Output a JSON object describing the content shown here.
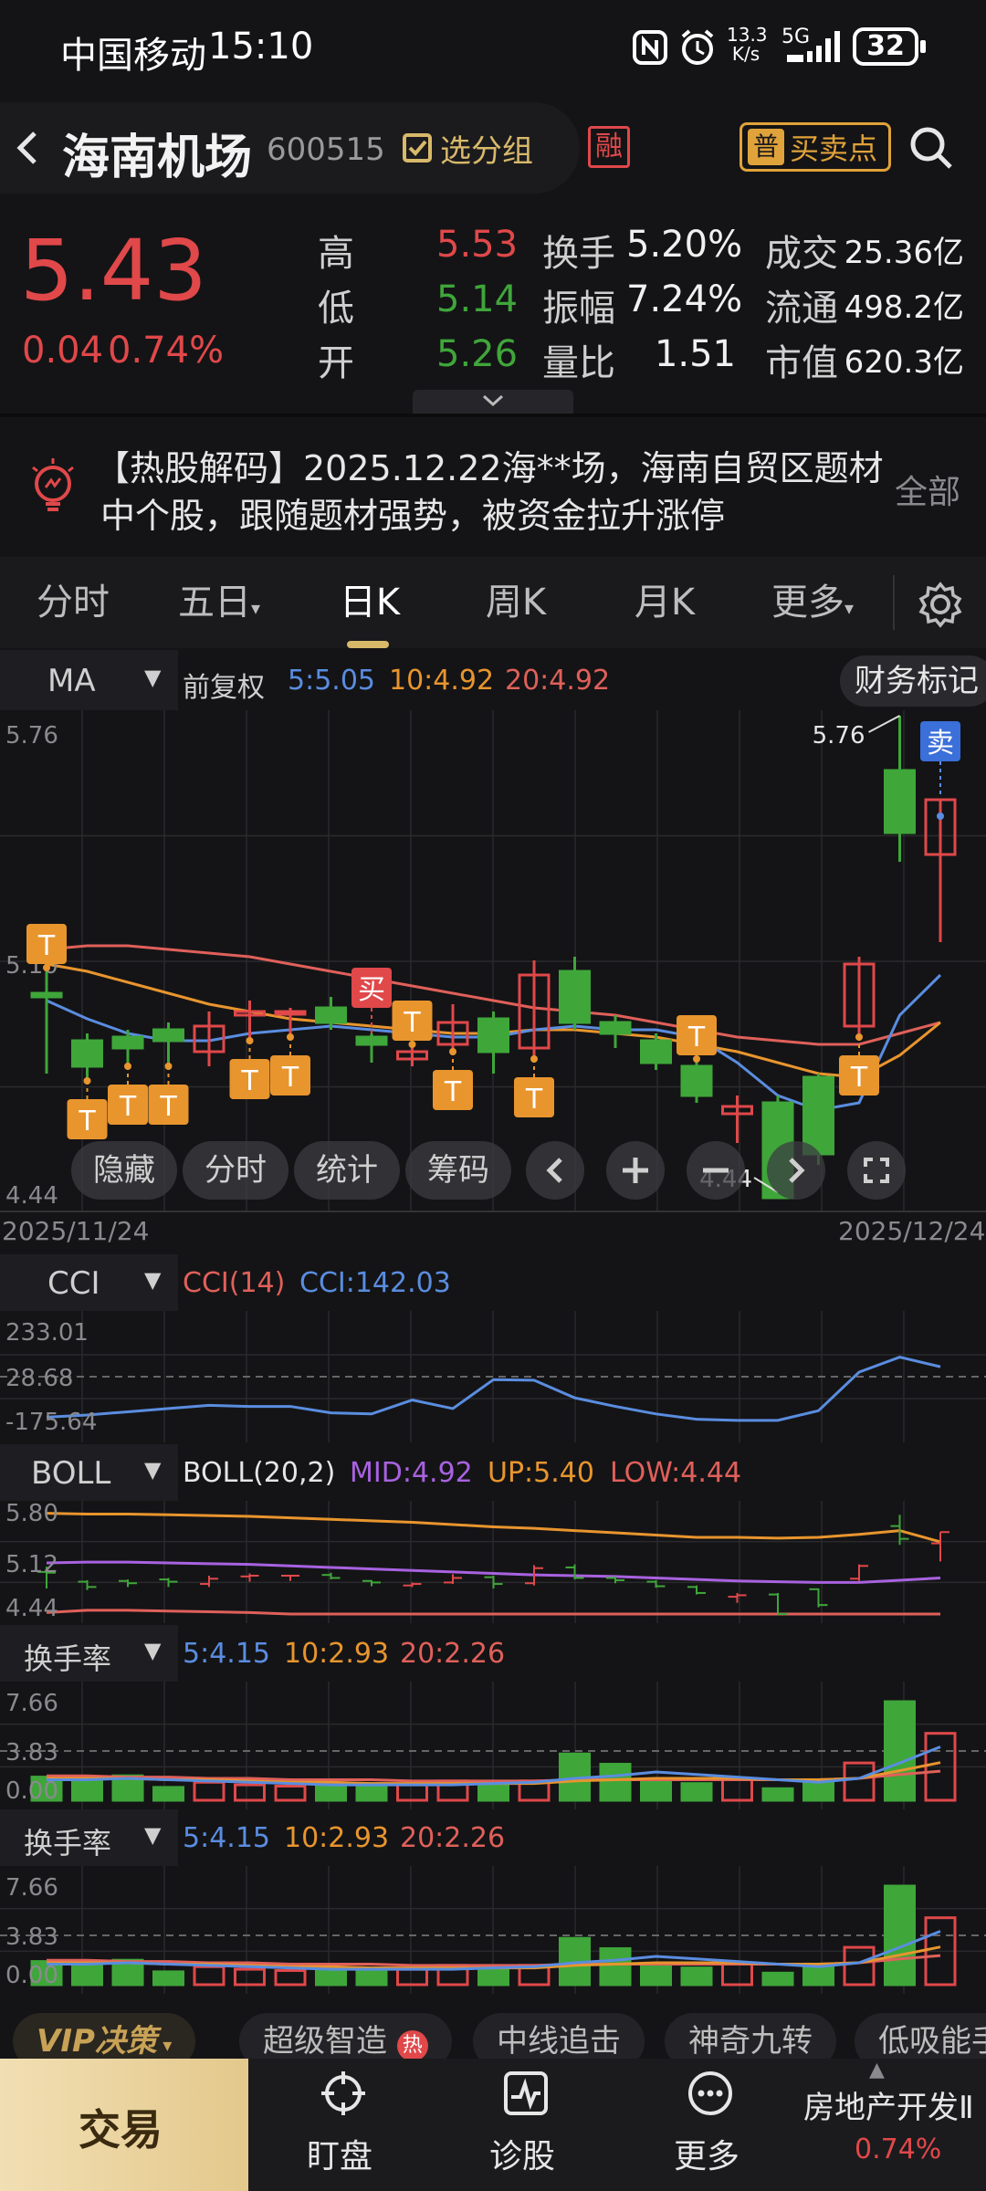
{
  "status": {
    "carrier": "中国移动",
    "time": "15:10",
    "net_speed_top": "13.3",
    "net_speed_unit": "K/s",
    "net_type": "5G",
    "battery": "32"
  },
  "header": {
    "stock_name": "海南机场",
    "stock_code": "600515",
    "group_button": "选分组",
    "margin_badge": "融",
    "trade_badge": "普",
    "trade_button": "买卖点"
  },
  "quote": {
    "price": "5.43",
    "change": "0.04",
    "change_pct": "0.74%",
    "high_label": "高",
    "high": "5.53",
    "low_label": "低",
    "low": "5.14",
    "open_label": "开",
    "open": "5.26",
    "turnover_label": "换手",
    "turnover": "5.20%",
    "amplitude_label": "振幅",
    "amplitude": "7.24%",
    "vol_ratio_label": "量比",
    "vol_ratio": "1.51",
    "amount_label": "成交",
    "amount": "25.36亿",
    "float_label": "流通",
    "float_cap": "498.2亿",
    "mcap_label": "市值",
    "mcap": "620.3亿"
  },
  "news": {
    "line1": "【热股解码】2025.12.22海**场，海南自贸区题材",
    "line2": "中个股，跟随题材强势，被资金拉升涨停",
    "more": "全部"
  },
  "tabs": [
    "分时",
    "五日",
    "日K",
    "周K",
    "月K",
    "更多"
  ],
  "active_tab": "日K",
  "main_chart": {
    "indicator": "MA",
    "adjust": "前复权",
    "ma5": "5:5.05",
    "ma10": "10:4.92",
    "ma20": "20:4.92",
    "finance_tag": "财务标记",
    "y_top": "5.76",
    "y_mid": "5.10",
    "y_bot": "4.44",
    "max_label": "5.76",
    "min_label": "4.44",
    "date_start": "2025/11/24",
    "date_end": "2025/12/24",
    "tools": [
      "隐藏",
      "分时",
      "统计",
      "筹码"
    ],
    "buy_mark": "买",
    "sell_mark": "卖",
    "t_mark": "T"
  },
  "cci": {
    "name": "CCI",
    "param": "CCI(14)",
    "value": "CCI:142.03",
    "y_top": "233.01",
    "y_mid": "28.68",
    "y_bot": "-175.64"
  },
  "boll": {
    "name": "BOLL",
    "param": "BOLL(20,2)",
    "mid": "MID:4.92",
    "up": "UP:5.40",
    "low": "LOW:4.44",
    "y_top": "5.80",
    "y_mid": "5.12",
    "y_bot": "4.44"
  },
  "turnover1": {
    "name": "换手率",
    "ma5": "5:4.15",
    "ma10": "10:2.93",
    "ma20": "20:2.26",
    "y_top": "7.66",
    "y_mid": "3.83",
    "y_bot": "0.00"
  },
  "turnover2": {
    "name": "换手率",
    "ma5": "5:4.15",
    "ma10": "10:2.93",
    "ma20": "20:2.26",
    "y_top": "7.66",
    "y_mid": "3.83",
    "y_bot": "0.00"
  },
  "chips": [
    "VIP决策",
    "超级智造",
    "中线追击",
    "神奇九转",
    "低吸能手"
  ],
  "hot_badge": "热",
  "bottom": {
    "trade": "交易",
    "watch": "盯盘",
    "diagnose": "诊股",
    "more": "更多",
    "sector": "房地产开发Ⅱ",
    "sector_pct": "0.74%"
  },
  "chart_data": {
    "type": "candlestick",
    "x_range": [
      "2025/11/24",
      "2025/12/24"
    ],
    "ohlc": [
      [
        5.0,
        4.99,
        5.07,
        4.78
      ],
      [
        4.87,
        4.8,
        4.89,
        4.76
      ],
      [
        4.88,
        4.85,
        4.9,
        4.8
      ],
      [
        4.9,
        4.87,
        4.92,
        4.8
      ],
      [
        4.84,
        4.91,
        4.95,
        4.8
      ],
      [
        4.94,
        4.95,
        4.98,
        4.87
      ],
      [
        4.95,
        4.95,
        4.96,
        4.88
      ],
      [
        4.96,
        4.92,
        4.99,
        4.9
      ],
      [
        4.88,
        4.86,
        4.89,
        4.81
      ],
      [
        4.82,
        4.84,
        4.86,
        4.8
      ],
      [
        4.86,
        4.92,
        4.97,
        4.84
      ],
      [
        4.93,
        4.84,
        4.95,
        4.78
      ],
      [
        4.85,
        5.05,
        5.09,
        4.82
      ],
      [
        5.06,
        4.92,
        5.1,
        4.9
      ],
      [
        4.92,
        4.89,
        4.94,
        4.85
      ],
      [
        4.87,
        4.81,
        4.89,
        4.79
      ],
      [
        4.8,
        4.72,
        4.82,
        4.7
      ],
      [
        4.67,
        4.69,
        4.72,
        4.59
      ],
      [
        4.7,
        4.44,
        4.72,
        4.44
      ],
      [
        4.77,
        4.56,
        4.78,
        4.53
      ],
      [
        4.91,
        5.08,
        5.1,
        4.88
      ],
      [
        5.61,
        5.44,
        5.76,
        5.36
      ],
      [
        5.38,
        5.53,
        5.53,
        5.14
      ]
    ],
    "ma5": [
      4.98,
      4.93,
      4.89,
      4.87,
      4.87,
      4.89,
      4.9,
      4.91,
      4.9,
      4.89,
      4.88,
      4.88,
      4.9,
      4.91,
      4.9,
      4.9,
      4.88,
      4.81,
      4.72,
      4.68,
      4.7,
      4.94,
      5.05
    ],
    "ma10": [
      5.08,
      5.06,
      5.03,
      5.0,
      4.97,
      4.95,
      4.93,
      4.92,
      4.91,
      4.9,
      4.89,
      4.89,
      4.9,
      4.9,
      4.89,
      4.88,
      4.86,
      4.84,
      4.81,
      4.78,
      4.77,
      4.83,
      4.92
    ],
    "ma20": [
      5.12,
      5.13,
      5.13,
      5.12,
      5.11,
      5.1,
      5.08,
      5.06,
      5.04,
      5.02,
      5.0,
      4.98,
      4.96,
      4.95,
      4.94,
      4.92,
      4.9,
      4.88,
      4.87,
      4.86,
      4.86,
      4.89,
      4.92
    ],
    "cci": [
      -160,
      -150,
      -135,
      -120,
      -105,
      -110,
      -110,
      -140,
      -145,
      -80,
      -120,
      15,
      12,
      -70,
      -110,
      -145,
      -170,
      -175,
      -175,
      -130,
      50,
      120,
      75
    ],
    "boll_up": [
      5.78,
      5.77,
      5.77,
      5.76,
      5.75,
      5.74,
      5.72,
      5.7,
      5.68,
      5.66,
      5.63,
      5.6,
      5.58,
      5.55,
      5.52,
      5.49,
      5.46,
      5.46,
      5.45,
      5.46,
      5.5,
      5.55,
      5.4
    ],
    "boll_mid": [
      5.12,
      5.13,
      5.13,
      5.12,
      5.11,
      5.1,
      5.08,
      5.06,
      5.04,
      5.02,
      5.0,
      4.98,
      4.96,
      4.95,
      4.94,
      4.92,
      4.9,
      4.88,
      4.87,
      4.86,
      4.86,
      4.89,
      4.92
    ],
    "boll_low": [
      4.46,
      4.49,
      4.49,
      4.48,
      4.47,
      4.46,
      4.44,
      4.42,
      4.4,
      4.38,
      4.37,
      4.36,
      4.34,
      4.35,
      4.36,
      4.35,
      4.34,
      4.3,
      4.29,
      4.26,
      4.22,
      4.23,
      4.44
    ],
    "turnover": [
      1.8,
      1.6,
      1.9,
      1.0,
      1.4,
      1.2,
      1.1,
      1.1,
      1.3,
      1.2,
      1.5,
      1.3,
      1.5,
      3.6,
      2.8,
      1.5,
      1.3,
      1.7,
      0.9,
      1.6,
      2.9,
      7.66,
      5.2
    ],
    "turnover_ma5": [
      1.6,
      1.6,
      1.7,
      1.6,
      1.5,
      1.4,
      1.3,
      1.2,
      1.2,
      1.2,
      1.2,
      1.3,
      1.4,
      1.7,
      1.9,
      2.2,
      2.0,
      1.8,
      1.6,
      1.4,
      1.7,
      2.9,
      4.15
    ],
    "turnover_ma10": [
      1.7,
      1.7,
      1.7,
      1.6,
      1.6,
      1.5,
      1.4,
      1.4,
      1.3,
      1.3,
      1.3,
      1.3,
      1.3,
      1.5,
      1.6,
      1.7,
      1.7,
      1.7,
      1.6,
      1.6,
      1.7,
      2.3,
      2.93
    ],
    "turnover_ma20": [
      1.9,
      1.9,
      1.8,
      1.8,
      1.7,
      1.7,
      1.6,
      1.6,
      1.6,
      1.5,
      1.5,
      1.5,
      1.5,
      1.6,
      1.6,
      1.6,
      1.6,
      1.6,
      1.6,
      1.6,
      1.7,
      2.0,
      2.26
    ]
  }
}
